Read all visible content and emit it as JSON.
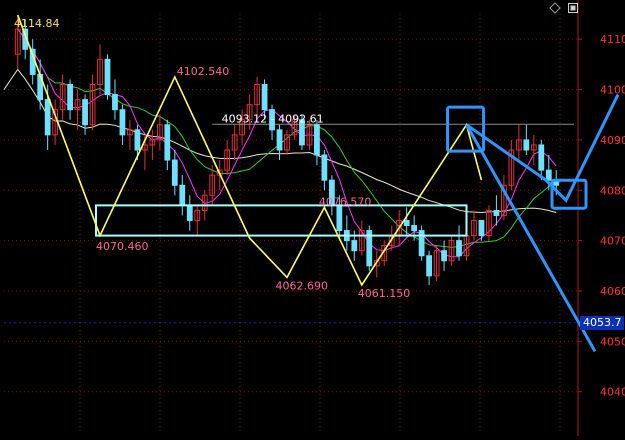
{
  "header": {
    "series_value": "4114.84"
  },
  "toolbar": {
    "diamond_icon": "diamond-icon",
    "window_icon": "window-icon"
  },
  "current_price_label": "4053.7",
  "colors": {
    "background": "#000000",
    "grid": "#7a1010",
    "axis": "#b01818",
    "up_candle": "#e0303a",
    "down_candle": "#6fe0ff",
    "zigzag": "#ffff66",
    "ma_short": "#ff33ff",
    "ma_mid": "#33cc33",
    "ma_long": "#e8e8c8",
    "box": "#a8ffff",
    "annotation": "#2f95ff",
    "label": "#ff6699",
    "axis_text": "#ff3333"
  },
  "chart_data": {
    "type": "candlestick",
    "y_axis": {
      "ticks": [
        "4110",
        "4100",
        "4090",
        "4080",
        "4070",
        "4060",
        "4050",
        "4040"
      ],
      "range": [
        4032,
        4115
      ]
    },
    "grid": true,
    "candles": [
      [
        4107,
        4114.8,
        4104,
        4112
      ],
      [
        4112,
        4114,
        4106,
        4108
      ],
      [
        4108,
        4110,
        4101,
        4103
      ],
      [
        4103,
        4106,
        4096,
        4098
      ],
      [
        4098,
        4101,
        4088,
        4091
      ],
      [
        4091,
        4098,
        4089,
        4096
      ],
      [
        4096,
        4103,
        4094,
        4101
      ],
      [
        4101,
        4102,
        4094,
        4096
      ],
      [
        4096,
        4100,
        4092,
        4098
      ],
      [
        4098,
        4099,
        4091,
        4093
      ],
      [
        4093,
        4103,
        4092,
        4101
      ],
      [
        4101,
        4109,
        4099,
        4106
      ],
      [
        4106,
        4107,
        4098,
        4099
      ],
      [
        4099,
        4102,
        4094,
        4096
      ],
      [
        4096,
        4097,
        4089,
        4091
      ],
      [
        4091,
        4094,
        4088,
        4092
      ],
      [
        4092,
        4093,
        4086,
        4088
      ],
      [
        4088,
        4091,
        4084,
        4089
      ],
      [
        4089,
        4092,
        4086,
        4090
      ],
      [
        4090,
        4095,
        4088,
        4093
      ],
      [
        4093,
        4094,
        4084,
        4086
      ],
      [
        4086,
        4088,
        4079,
        4081
      ],
      [
        4081,
        4083,
        4075,
        4077
      ],
      [
        4077,
        4079,
        4072,
        4074
      ],
      [
        4074,
        4077,
        4071,
        4076
      ],
      [
        4076,
        4080,
        4074,
        4079
      ],
      [
        4079,
        4085,
        4077,
        4083
      ],
      [
        4083,
        4086,
        4080,
        4084
      ],
      [
        4084,
        4090,
        4083,
        4088
      ],
      [
        4088,
        4093,
        4086,
        4091
      ],
      [
        4091,
        4096,
        4089,
        4094
      ],
      [
        4094,
        4099,
        4092,
        4097
      ],
      [
        4097,
        4102.5,
        4095,
        4101
      ],
      [
        4101,
        4102,
        4094,
        4096
      ],
      [
        4096,
        4097,
        4090,
        4092
      ],
      [
        4092,
        4093,
        4086,
        4088
      ],
      [
        4088,
        4092,
        4087,
        4091
      ],
      [
        4091,
        4095,
        4090,
        4094
      ],
      [
        4094,
        4095,
        4088,
        4089
      ],
      [
        4089,
        4094,
        4088,
        4093
      ],
      [
        4093,
        4094,
        4085,
        4087
      ],
      [
        4087,
        4088,
        4080,
        4082
      ],
      [
        4082,
        4083,
        4075,
        4077
      ],
      [
        4077,
        4079,
        4070,
        4072
      ],
      [
        4072,
        4075,
        4068,
        4070
      ],
      [
        4070,
        4072,
        4066,
        4068
      ],
      [
        4068,
        4074,
        4067,
        4072
      ],
      [
        4072,
        4073,
        4064,
        4065
      ],
      [
        4065,
        4068,
        4062.7,
        4066
      ],
      [
        4066,
        4070,
        4065,
        4069
      ],
      [
        4069,
        4073,
        4068,
        4071
      ],
      [
        4071,
        4076,
        4069,
        4074
      ],
      [
        4074,
        4076.6,
        4071,
        4073
      ],
      [
        4073,
        4075,
        4070,
        4072
      ],
      [
        4072,
        4073,
        4066,
        4067
      ],
      [
        4067,
        4068,
        4061.2,
        4063
      ],
      [
        4063,
        4069,
        4062,
        4068
      ],
      [
        4068,
        4070,
        4064,
        4066
      ],
      [
        4066,
        4071,
        4065,
        4070
      ],
      [
        4070,
        4073,
        4066,
        4067
      ],
      [
        4067,
        4072,
        4066,
        4071
      ],
      [
        4071,
        4076,
        4070,
        4074
      ],
      [
        4074,
        4073,
        4070,
        4071
      ],
      [
        4071,
        4077,
        4070,
        4076
      ],
      [
        4076,
        4079,
        4073,
        4075
      ],
      [
        4075,
        4083,
        4074,
        4081
      ],
      [
        4081,
        4090,
        4080,
        4088
      ],
      [
        4088,
        4093,
        4086,
        4090
      ],
      [
        4090,
        4093,
        4087,
        4088
      ],
      [
        4088,
        4091,
        4085,
        4089
      ],
      [
        4089,
        4090,
        4082,
        4084
      ],
      [
        4084,
        4087,
        4080,
        4082
      ],
      [
        4082,
        4084,
        4079,
        4081
      ]
    ],
    "zigzag": [
      {
        "i": 0,
        "price": 4114.8
      },
      {
        "i": 11,
        "price": 4071.0
      },
      {
        "i": 21,
        "price": 4102.5
      },
      {
        "i": 31,
        "price": 4070.5
      },
      {
        "i": 36,
        "price": 4062.7
      },
      {
        "i": 41,
        "price": 4076.6
      },
      {
        "i": 46,
        "price": 4061.2
      },
      {
        "i": 60,
        "price": 4093.0
      },
      {
        "i": 62,
        "price": 4082.0
      }
    ],
    "annotations": [
      {
        "text": "4114.84",
        "i": 1,
        "price": 4114.8
      },
      {
        "text": "4102.540",
        "i": 21,
        "price": 4102.5
      },
      {
        "text": "4093.12 - 4092.61",
        "i": 27,
        "price": 4093.1
      },
      {
        "text": "4076.570",
        "i": 40,
        "price": 4076.6
      },
      {
        "text": "4070.460",
        "i": 11,
        "price": 4070.5
      },
      {
        "text": "4062.690",
        "i": 35,
        "price": 4062.7
      },
      {
        "text": "4061.150",
        "i": 46,
        "price": 4061.2
      }
    ],
    "support_box": {
      "price_top": 4077,
      "price_bottom": 4071
    },
    "resistance_line": 4093.1,
    "current_price": 4053.7
  }
}
